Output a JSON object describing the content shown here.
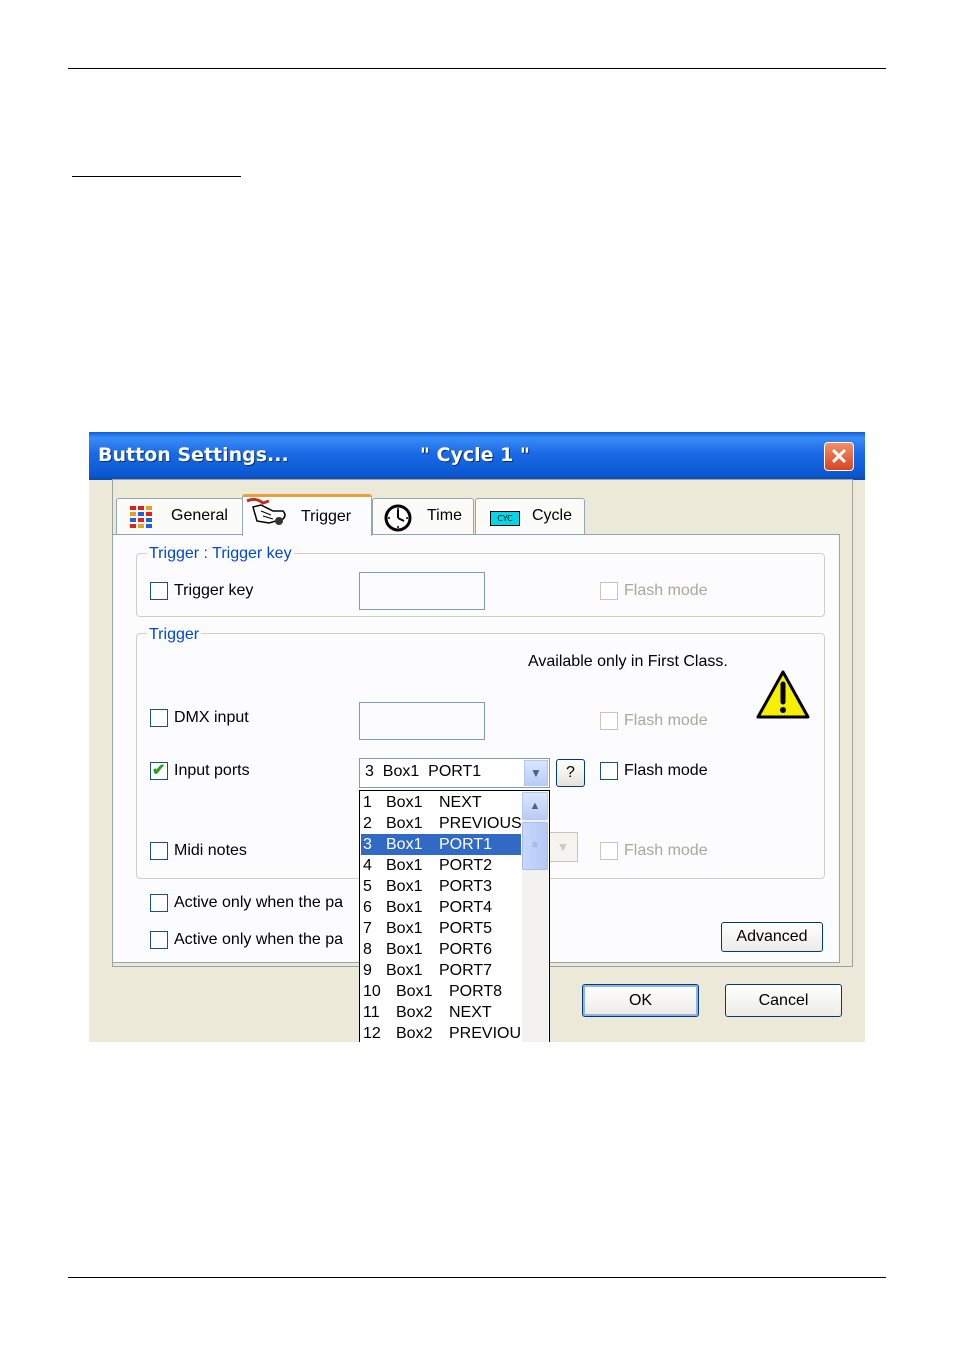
{
  "window": {
    "title": "Button  Settings...",
    "subtitle": "\" Cycle 1 \"",
    "close": "✕"
  },
  "tabs": [
    {
      "label": "General",
      "icon": "color-grid-icon"
    },
    {
      "label": "Trigger",
      "icon": "hand-icon"
    },
    {
      "label": "Time",
      "icon": "clock-icon"
    },
    {
      "label": "Cycle",
      "icon": "cyc-icon",
      "icon_text": "CYC"
    }
  ],
  "group_trigger_key": {
    "label": "Trigger : Trigger key",
    "trigger_key": {
      "label": "Trigger key",
      "checked": false
    },
    "flash_mode": {
      "label": "Flash mode",
      "enabled": false
    }
  },
  "group_trigger": {
    "label": "Trigger",
    "note": "Available only in First Class.",
    "dmx_input": {
      "label": "DMX input",
      "checked": false
    },
    "dmx_flash": {
      "label": "Flash mode",
      "enabled": false
    },
    "input_ports": {
      "label": "Input ports",
      "checked": true,
      "selected": "3  Box1  PORT1"
    },
    "help_button": "?",
    "input_flash": {
      "label": "Flash mode",
      "checked": false
    },
    "midi_notes": {
      "label": "Midi notes",
      "checked": false
    },
    "midi_flash": {
      "label": "Flash mode",
      "enabled": false
    }
  },
  "active1": {
    "label": "Active only when the pa",
    "checked": false
  },
  "active2": {
    "label": "Active only when the pa",
    "checked": false
  },
  "buttons": {
    "advanced": "Advanced",
    "ok": "OK",
    "cancel": "Cancel"
  },
  "dropdown": {
    "items": [
      {
        "n": "1",
        "box": "Box1",
        "port": "NEXT"
      },
      {
        "n": "2",
        "box": "Box1",
        "port": "PREVIOUS"
      },
      {
        "n": "3",
        "box": "Box1",
        "port": "PORT1"
      },
      {
        "n": "4",
        "box": "Box1",
        "port": "PORT2"
      },
      {
        "n": "5",
        "box": "Box1",
        "port": "PORT3"
      },
      {
        "n": "6",
        "box": "Box1",
        "port": "PORT4"
      },
      {
        "n": "7",
        "box": "Box1",
        "port": "PORT5"
      },
      {
        "n": "8",
        "box": "Box1",
        "port": "PORT6"
      },
      {
        "n": "9",
        "box": "Box1",
        "port": "PORT7"
      },
      {
        "n": "10",
        "box": "Box1",
        "port": "PORT8"
      },
      {
        "n": "11",
        "box": "Box2",
        "port": "NEXT"
      },
      {
        "n": "12",
        "box": "Box2",
        "port": "PREVIOU"
      }
    ],
    "selected_index": 2
  },
  "colors": {
    "title_bar": "#0b57d0",
    "selection": "#316ac5",
    "group_label": "#0046d5",
    "check": "#21a121"
  }
}
